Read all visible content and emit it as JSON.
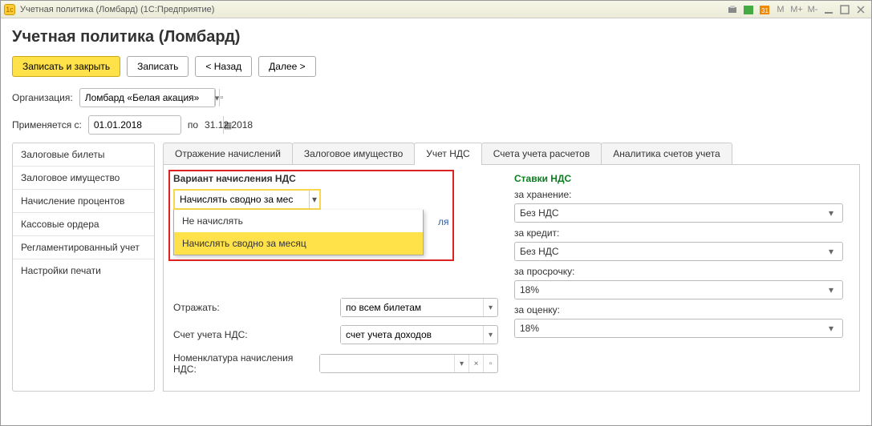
{
  "titlebar": {
    "title": "Учетная политика (Ломбард)  (1С:Предприятие)",
    "icons": [
      "print",
      "cal-green",
      "cal-orange",
      "M",
      "M+",
      "M-",
      "min",
      "max",
      "close"
    ]
  },
  "header": {
    "title": "Учетная политика (Ломбард)"
  },
  "toolbar": {
    "save_close": "Записать и закрыть",
    "save": "Записать",
    "back": "< Назад",
    "next": "Далее >"
  },
  "org": {
    "label": "Организация:",
    "value": "Ломбард «Белая акация»"
  },
  "applies": {
    "label": "Применяется с:",
    "value": "01.01.2018",
    "to": "по",
    "end": "31.12.2018"
  },
  "sidebar": {
    "items": [
      "Залоговые билеты",
      "Залоговое имущество",
      "Начисление процентов",
      "Кассовые ордера",
      "Регламентированный учет",
      "Настройки печати"
    ]
  },
  "tabs": [
    "Отражение начислений",
    "Залоговое имущество",
    "Учет НДС",
    "Счета учета расчетов",
    "Аналитика счетов учета"
  ],
  "active_tab": 2,
  "nds": {
    "variant_label": "Вариант начисления НДС",
    "variant_value": "Начислять сводно за мес",
    "options": [
      "Не начислять",
      "Начислять сводно за месяц"
    ],
    "selected_option": 1,
    "behind_text_right": "ля",
    "reflect_label": "Отражать:",
    "reflect_value": "по всем билетам",
    "account_label": "Счет учета НДС:",
    "account_value": "счет учета доходов",
    "nomenclature_label": "Номенклатура начисления НДС:",
    "nomenclature_value": ""
  },
  "rates": {
    "title": "Ставки НДС",
    "storage_label": "за хранение:",
    "storage_value": "Без НДС",
    "credit_label": "за кредит:",
    "credit_value": "Без НДС",
    "late_label": "за просрочку:",
    "late_value": "18%",
    "appraisal_label": "за оценку:",
    "appraisal_value": "18%"
  }
}
